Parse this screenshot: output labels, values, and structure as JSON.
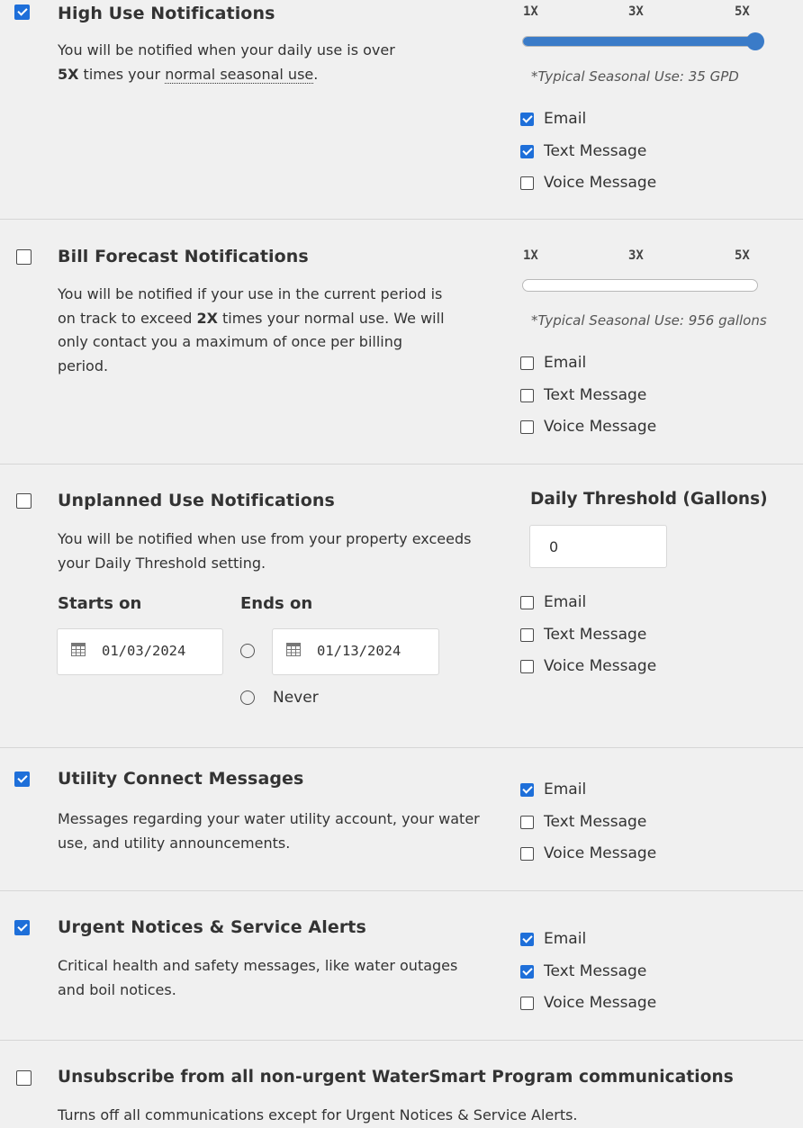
{
  "high_use": {
    "checked": true,
    "title": "High Use Notifications",
    "desc_pre": "You will be notified when your daily use is over",
    "desc_bold": "5X",
    "desc_mid": " times your ",
    "desc_link": "normal seasonal use",
    "desc_post": ".",
    "scale": [
      "1X",
      "3X",
      "5X"
    ],
    "slider_value": "5X",
    "slider_fraction": 1.0,
    "typical": "*Typical Seasonal Use: 35 GPD",
    "options": [
      {
        "label": "Email",
        "checked": true
      },
      {
        "label": "Text Message",
        "checked": true
      },
      {
        "label": "Voice Message",
        "checked": false
      }
    ]
  },
  "bill_forecast": {
    "checked": false,
    "title": "Bill Forecast Notifications",
    "desc_pre": "You will be notified if your use in the current period is on track to exceed ",
    "desc_bold": "2X",
    "desc_post": " times your normal use. We will only contact you a maximum of once per billing period.",
    "scale": [
      "1X",
      "3X",
      "5X"
    ],
    "slider_fraction": 0,
    "typical": "*Typical Seasonal Use: 956 gallons",
    "options": [
      {
        "label": "Email",
        "checked": false
      },
      {
        "label": "Text Message",
        "checked": false
      },
      {
        "label": "Voice Message",
        "checked": false
      }
    ]
  },
  "unplanned": {
    "checked": false,
    "title": "Unplanned Use Notifications",
    "desc": "You will be notified when use from your property exceeds your Daily Threshold setting.",
    "threshold_label": "Daily Threshold (Gallons)",
    "threshold_value": "0",
    "starts_label": "Starts on",
    "ends_label": "Ends on",
    "start_date": "01/03/2024",
    "end_date": "01/13/2024",
    "never_label": "Never",
    "options": [
      {
        "label": "Email",
        "checked": false
      },
      {
        "label": "Text Message",
        "checked": false
      },
      {
        "label": "Voice Message",
        "checked": false
      }
    ]
  },
  "utility_connect": {
    "checked": true,
    "title": "Utility Connect Messages",
    "desc": "Messages regarding your water utility account, your water use, and utility announcements.",
    "options": [
      {
        "label": "Email",
        "checked": true
      },
      {
        "label": "Text Message",
        "checked": false
      },
      {
        "label": "Voice Message",
        "checked": false
      }
    ]
  },
  "urgent": {
    "checked": true,
    "title": "Urgent Notices & Service Alerts",
    "desc": "Critical health and safety messages, like water outages and boil notices.",
    "options": [
      {
        "label": "Email",
        "checked": true
      },
      {
        "label": "Text Message",
        "checked": true
      },
      {
        "label": "Voice Message",
        "checked": false
      }
    ]
  },
  "unsubscribe": {
    "checked": false,
    "title": "Unsubscribe from all non-urgent WaterSmart Program communications",
    "desc": "Turns off all communications except for Urgent Notices & Service Alerts."
  },
  "colors": {
    "accent": "#1e6fd9",
    "slider": "#3a7bc8",
    "background": "#f0f0f0",
    "text": "#333333"
  }
}
